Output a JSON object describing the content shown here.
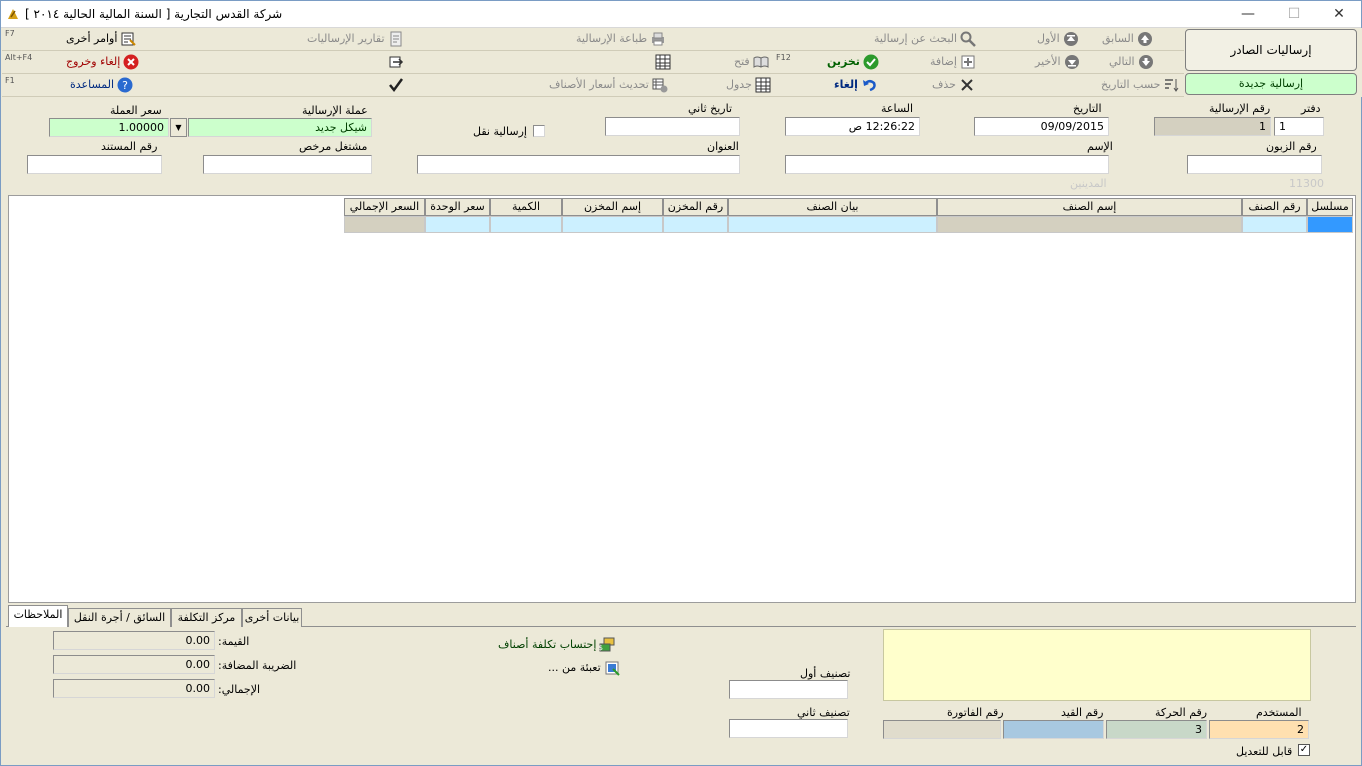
{
  "window": {
    "title": "شركة القدس التجارية  [ السنة المالية الحالية ٢٠١٤ ]",
    "minimize": "—",
    "maximize": "☐",
    "close": "✕"
  },
  "toolbar": {
    "row1": {
      "previous": "السابق",
      "first": "الأول",
      "search": "البحث عن إرسالية",
      "print": "طباعة الإرسالية",
      "reports": "تقارير الإرساليات",
      "other_commands": "أوامر أخرى",
      "other_fkey": "F7"
    },
    "row2": {
      "next": "التالي",
      "last": "الأخير",
      "add": "إضافة",
      "save": "تخزين",
      "open_fkey": "F12",
      "open": "فتح",
      "cancel_exit": "إلغاء وخروج",
      "cancel_exit_fkey": "Alt+F4"
    },
    "row3": {
      "by_date": "حسب التاريخ",
      "delete": "حذف",
      "cancel": "إلغاء",
      "table": "جدول",
      "update_prices": "تحديث أسعار الأصناف",
      "help": "المساعدة",
      "help_fkey": "F1"
    }
  },
  "side": {
    "title": "إرساليات الصادر",
    "new_button": "إرسالية جديدة"
  },
  "form": {
    "book_label": "دفتر",
    "book_value": "1",
    "shipment_no_label": "رقم الإرسالية",
    "shipment_no_value": "1",
    "date_label": "التاريخ",
    "date_value": "09/09/2015",
    "time_label": "الساعة",
    "time_value": "12:26:22 ص",
    "date2_label": "تاريخ ثاني",
    "date2_value": "",
    "transport_label": "إرسالية نقل",
    "currency_label": "عملة الإرسالية",
    "currency_value": "شيكل جديد",
    "rate_label": "سعر العملة",
    "rate_value": "1.00000",
    "customer_no_label": "رقم الزبون",
    "customer_no_value": "",
    "customer_code_hint": "11300",
    "debtors_hint": "المدينين",
    "name_label": "الإسم",
    "name_value": "",
    "address_label": "العنوان",
    "address_value": "",
    "licensed_label": "مشتغل مرخص",
    "licensed_value": "",
    "doc_no_label": "رقم المستند",
    "doc_no_value": ""
  },
  "grid": {
    "columns": [
      "مسلسل",
      "رقم الصنف",
      "إسم الصنف",
      "بيان الصنف",
      "رقم المخزن",
      "إسم المخزن",
      "الكمية",
      "سعر الوحدة",
      "السعر الإجمالي"
    ]
  },
  "tabs": [
    "الملاحظات",
    "بيانات أخرى",
    "مركز التكلفة",
    "السائق / أجرة النقل"
  ],
  "bottom": {
    "value_label": "القيمة:",
    "value": "0.00",
    "vat_label": "الضريبة المضافة:",
    "vat": "0.00",
    "total_label": "الإجمالي:",
    "total": "0.00",
    "calc_cost": "إحتساب تكلفة أصناف",
    "fill_from": "تعبئة من ...",
    "class1_label": "تصنيف أول",
    "class1_value": "",
    "class2_label": "تصنيف ثاني",
    "class2_value": "",
    "user_label": "المستخدم",
    "user_value": "2",
    "movement_label": "رقم الحركة",
    "movement_value": "3",
    "entry_label": "رقم القيد",
    "entry_value": "",
    "invoice_label": "رقم الفاتورة",
    "invoice_value": "",
    "editable_label": "قابل للتعديل"
  },
  "colors": {
    "green_field": "#ccffcc",
    "light_blue": "#ccf0ff",
    "notes_yellow": "#ffffcc",
    "user_orange": "#ffe0b0",
    "entry_blue": "#a8c8e0",
    "movement_green": "#c8d8c8"
  }
}
